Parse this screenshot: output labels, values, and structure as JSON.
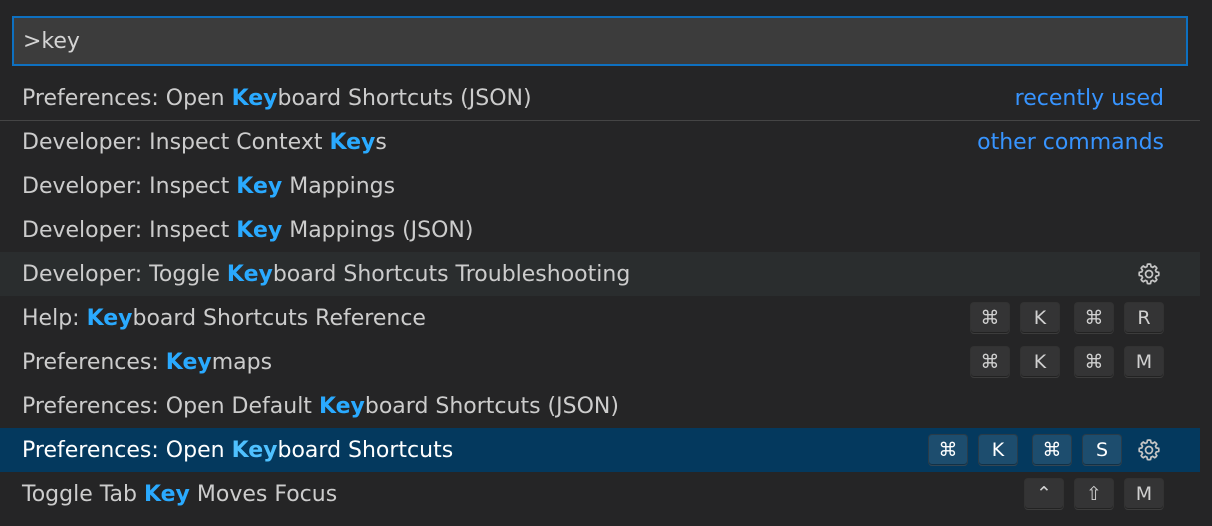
{
  "search": {
    "value": ">key",
    "placeholder": ""
  },
  "items": [
    {
      "pre": "Preferences: Open ",
      "hl": "Key",
      "post": "board Shortcuts (JSON)",
      "group": "recently used"
    },
    {
      "pre": "Developer: Inspect Context ",
      "hl": "Key",
      "post": "s",
      "group": "other commands"
    },
    {
      "pre": "Developer: Inspect ",
      "hl": "Key",
      "post": " Mappings"
    },
    {
      "pre": "Developer: Inspect ",
      "hl": "Key",
      "post": " Mappings (JSON)"
    },
    {
      "pre": "Developer: Toggle ",
      "hl": "Key",
      "post": "board Shortcuts Troubleshooting",
      "gear": "gear-icon"
    },
    {
      "pre": "Help: ",
      "hl": "Key",
      "post": "board Shortcuts Reference",
      "keys": [
        [
          "⌘",
          "K"
        ],
        [
          "⌘",
          "R"
        ]
      ]
    },
    {
      "pre": "Preferences: ",
      "hl": "Key",
      "post": "maps",
      "keys": [
        [
          "⌘",
          "K"
        ],
        [
          "⌘",
          "M"
        ]
      ]
    },
    {
      "pre": "Preferences: Open Default ",
      "hl": "Key",
      "post": "board Shortcuts (JSON)"
    },
    {
      "pre": "Preferences: Open ",
      "hl": "Key",
      "post": "board Shortcuts",
      "keys": [
        [
          "⌘",
          "K"
        ],
        [
          "⌘",
          "S"
        ]
      ],
      "gear": "gear-icon",
      "selected": true
    },
    {
      "pre": "Toggle Tab ",
      "hl": "Key",
      "post": " Moves Focus",
      "keys": [
        [
          "⌃",
          "⇧",
          "M"
        ]
      ]
    }
  ],
  "colors": {
    "highlight": "#2aaaff",
    "group_label": "#3794ff",
    "selected_bg": "#04395e",
    "input_border": "#0e70c0"
  }
}
